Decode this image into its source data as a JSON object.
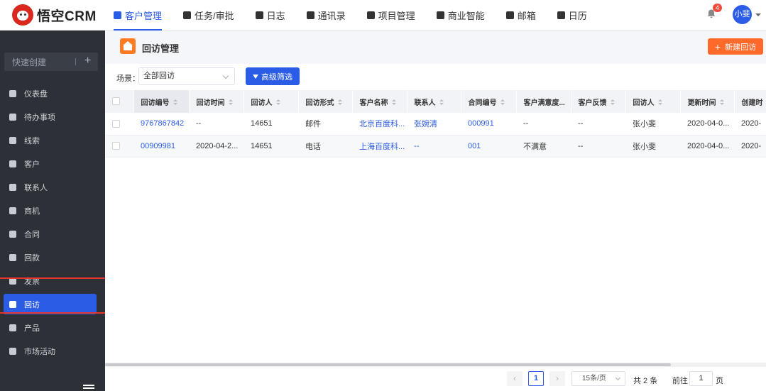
{
  "app": {
    "logo_text": "悟空CRM"
  },
  "nav": [
    {
      "label": "客户管理",
      "icon": "customer-icon",
      "active": true
    },
    {
      "label": "任务/审批",
      "icon": "briefcase-icon"
    },
    {
      "label": "日志",
      "icon": "log-icon"
    },
    {
      "label": "通讯录",
      "icon": "contacts-icon"
    },
    {
      "label": "项目管理",
      "icon": "project-icon"
    },
    {
      "label": "商业智能",
      "icon": "bi-icon"
    },
    {
      "label": "邮箱",
      "icon": "mail-icon"
    },
    {
      "label": "日历",
      "icon": "calendar-icon"
    }
  ],
  "header_right": {
    "notification_count": "4",
    "avatar_text": "小斐"
  },
  "sidebar": {
    "quick_create": "快速创建",
    "quick_plus": "+",
    "items": [
      {
        "label": "仪表盘",
        "icon": "dashboard-icon"
      },
      {
        "label": "待办事项",
        "icon": "todo-icon"
      },
      {
        "label": "线索",
        "icon": "lead-icon"
      },
      {
        "label": "客户",
        "icon": "customer-icon"
      },
      {
        "label": "联系人",
        "icon": "contact-icon"
      },
      {
        "label": "商机",
        "icon": "opportunity-icon"
      },
      {
        "label": "合同",
        "icon": "contract-icon"
      },
      {
        "label": "回款",
        "icon": "payment-icon"
      },
      {
        "label": "发票",
        "icon": "invoice-icon"
      },
      {
        "label": "回访",
        "icon": "home-icon",
        "active": true
      },
      {
        "label": "产品",
        "icon": "product-icon"
      },
      {
        "label": "市场活动",
        "icon": "campaign-icon"
      }
    ]
  },
  "page": {
    "title": "回访管理",
    "new_button": "新建回访",
    "new_plus": "+",
    "scene_label": "场景：",
    "scene_value": "全部回访",
    "filter_button": "高级筛选"
  },
  "table": {
    "columns": [
      "回访编号",
      "回访时间",
      "回访人",
      "回访形式",
      "客户名称",
      "联系人",
      "合同编号",
      "客户满意度...",
      "客户反馈",
      "回访人",
      "更新时间",
      "创建时"
    ],
    "rows": [
      [
        "9767867842",
        "--",
        "14651",
        "邮件",
        "北京百度科...",
        "张婉清",
        "000991",
        "--",
        "--",
        "张小斐",
        "2020-04-0...",
        "2020-"
      ],
      [
        "00909981",
        "2020-04-2...",
        "14651",
        "电话",
        "上海百度科...",
        "--",
        "001",
        "不满意",
        "--",
        "张小斐",
        "2020-04-0...",
        "2020-"
      ]
    ]
  },
  "pager": {
    "prev": "‹",
    "next": "›",
    "current_page": "1",
    "page_size": "15条/页",
    "total": "共 2 条",
    "goto_label": "前往",
    "goto_value": "1",
    "goto_unit": "页"
  },
  "colors": {
    "primary": "#2b5ce6",
    "accent": "#ff6a2b",
    "sidebar_bg": "#2d3037",
    "highlight_box": "#e8352b"
  }
}
